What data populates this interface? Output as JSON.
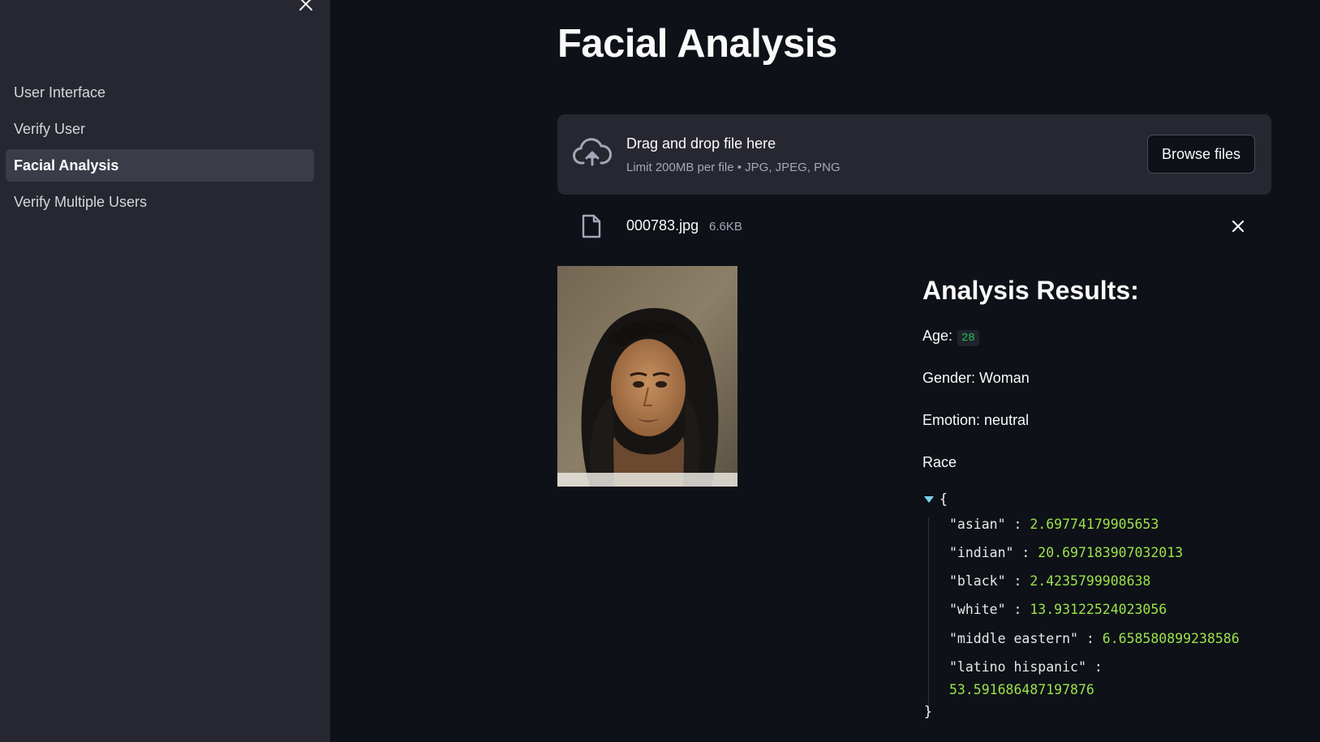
{
  "sidebar": {
    "items": [
      {
        "label": "User Interface",
        "active": false
      },
      {
        "label": "Verify User",
        "active": false
      },
      {
        "label": "Facial Analysis",
        "active": true
      },
      {
        "label": "Verify Multiple Users",
        "active": false
      }
    ]
  },
  "main": {
    "title": "Facial Analysis",
    "uploader": {
      "main_text": "Drag and drop file here",
      "sub_text": "Limit 200MB per file • JPG, JPEG, PNG",
      "browse_label": "Browse files"
    },
    "file": {
      "name": "000783.jpg",
      "size": "6.6KB"
    },
    "results": {
      "title": "Analysis Results:",
      "age_label": "Age:",
      "age_value": "28",
      "gender_text": "Gender: Woman",
      "emotion_text": "Emotion: neutral",
      "race_label": "Race",
      "race": [
        {
          "key": "\"asian\"",
          "value": "2.69774179905653"
        },
        {
          "key": "\"indian\"",
          "value": "20.697183907032013"
        },
        {
          "key": "\"black\"",
          "value": "2.4235799908638"
        },
        {
          "key": "\"white\"",
          "value": "13.93122524023056"
        },
        {
          "key": "\"middle eastern\"",
          "value": "6.658580899238586"
        },
        {
          "key": "\"latino hispanic\"",
          "value": "53.591686487197876"
        }
      ]
    }
  },
  "colors": {
    "background": "#0e1117",
    "sidebar": "#262730",
    "json_value": "#9ce34a",
    "age_code": "#21c354",
    "toggle": "#7ad3f5"
  },
  "icons": [
    "close-icon",
    "cloud-upload-icon",
    "file-icon",
    "remove-file-icon",
    "expand-toggle-icon"
  ]
}
